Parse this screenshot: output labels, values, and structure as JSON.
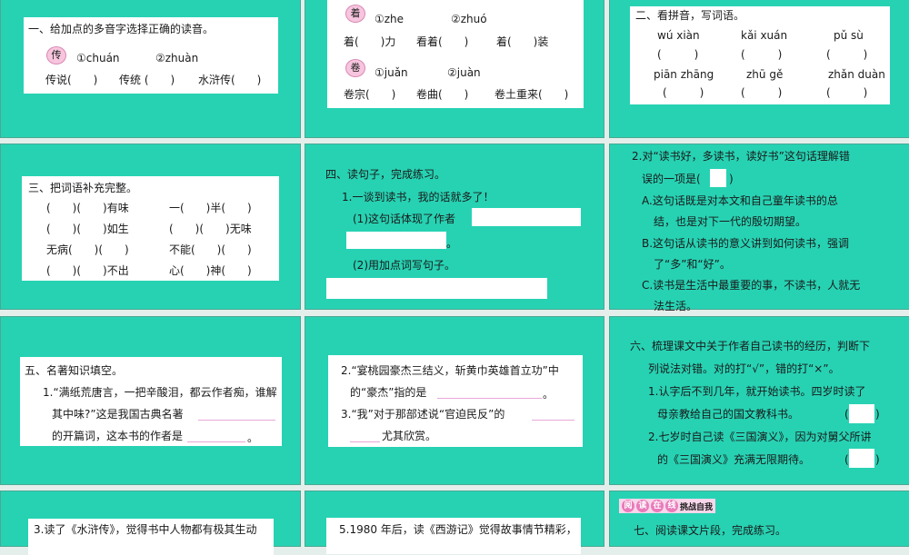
{
  "s1": {
    "title": "一、给加点的多音字选择正确的读音。",
    "char": "传",
    "opt1": "①chuán",
    "opt2": "②zhuàn",
    "words": [
      "传说(　　)",
      "传统 (　　)",
      "水浒传(　　)"
    ]
  },
  "s2": {
    "char1": "着",
    "opt1a": "①zhe",
    "opt1b": "②zhuó",
    "words1": [
      "着(　　)力",
      "看着(　　)",
      "着(　　)装"
    ],
    "char2": "卷",
    "opt2a": "①juǎn",
    "opt2b": "②juàn",
    "words2": [
      "卷宗(　　)",
      "卷曲(　　)",
      "卷土重来(　　)"
    ]
  },
  "s3": {
    "title": "二、看拼音，写词语。",
    "pinyin": [
      "wú xiàn",
      "kǎi xuán",
      "pǔ sù",
      "piān zhāng",
      "zhū gě",
      "zhǎn duàn"
    ],
    "paren": "(　　　)"
  },
  "s4": {
    "title": "三、把词语补充完整。",
    "rows": [
      [
        "(　　)(　　)有味",
        "一(　　)半(　　)"
      ],
      [
        "(　　)(　　)如生",
        "(　　)(　　)无味"
      ],
      [
        "无病(　　)(　　)",
        "不能(　　)(　　)"
      ],
      [
        "(　　)(　　)不出",
        "心(　　)神(　　)"
      ]
    ]
  },
  "s5": {
    "title": "四、读句子，完成练习。",
    "q1": "1.一谈到读书，我的话就多了！",
    "p1": "(1)这句话体现了作者",
    "end": "。",
    "p2": "(2)用加点词写句子。"
  },
  "s6": {
    "q": "2.对“读书好，多读书，读好书”这句话理解错",
    "q2": "误的一项是(",
    "q2end": ")",
    "a1": "A.这句话既是对本文和自己童年读书的总",
    "a2": "结，也是对下一代的殷切期望。",
    "b1": "B.这句话从读书的意义讲到如何读书，强调",
    "b2": "了“多”和“好”。",
    "c1": "C.读书是生活中最重要的事，不读书，人就无",
    "c2": "法生活。"
  },
  "s7": {
    "title": "五、名著知识填空。",
    "l1": "1.“满纸荒唐言，一把辛酸泪，都云作者痴，谁解",
    "l2": "其中味?”这是我国古典名著",
    "l3": "的开篇词，这本书的作者是",
    "end": "。"
  },
  "s8": {
    "l1": "2.“宴桃园豪杰三结义，斩黄巾英雄首立功”中",
    "l2": "的“豪杰”指的是",
    "end": "。",
    "l3": "3.“我”对于那部述说“官迫民反”的",
    "l4": "尤其欣赏。"
  },
  "s9": {
    "l1": "六、梳理课文中关于作者自己读书的经历，判断下",
    "l2": "列说法对错。对的打“√”，错的打“×”。",
    "l3": "1.认字后不到几年，就开始读书。四岁时读了",
    "l4": "母亲教给自己的国文教科书。",
    "l5": "2.七岁时自己读《三国演义》，因为对舅父所讲",
    "l6": "的《三国演义》充满无限期待。",
    "po": "(",
    "pc": ")"
  },
  "s10": {
    "l1": "3.读了《水浒传》，觉得书中人物都有极其生动"
  },
  "s11": {
    "l1": "5.1980 年后，读《西游记》觉得故事情节精彩，"
  },
  "s12": {
    "logo": [
      "阅",
      "读",
      "在",
      "线"
    ],
    "logo_sub": "挑战自我",
    "l1": "七、阅读课文片段，完成练习。"
  }
}
